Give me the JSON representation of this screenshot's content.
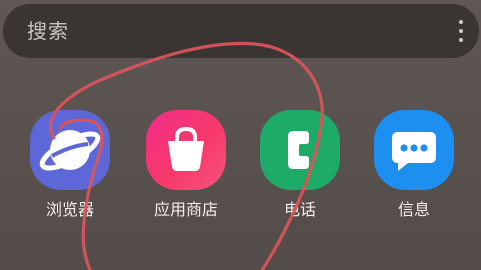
{
  "search": {
    "placeholder": "搜索",
    "menu_icon": "more-vertical-icon"
  },
  "apps": [
    {
      "label": "浏览器",
      "icon": "browser-planet-icon",
      "color": "#5d67d8"
    },
    {
      "label": "应用商店",
      "icon": "shopping-bag-icon",
      "color": "#f2307f"
    },
    {
      "label": "电话",
      "icon": "phone-handset-icon",
      "color": "#1eab67"
    },
    {
      "label": "信息",
      "icon": "message-bubble-icon",
      "color": "#1d8ff0"
    }
  ],
  "annotation": {
    "stroke_color": "#d9545a"
  }
}
